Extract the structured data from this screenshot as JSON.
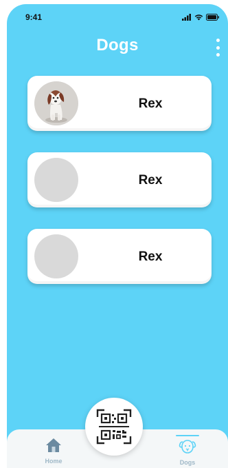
{
  "status_bar": {
    "time": "9:41"
  },
  "header": {
    "title": "Dogs"
  },
  "dogs": [
    {
      "name": "Rex",
      "has_photo": true
    },
    {
      "name": "Rex",
      "has_photo": false
    },
    {
      "name": "Rex",
      "has_photo": false
    }
  ],
  "tabs": [
    {
      "label": "Home",
      "icon": "home-icon",
      "active": false
    },
    {
      "label": "Dogs",
      "icon": "dog-icon",
      "active": true
    }
  ],
  "scan_button": {
    "icon": "qr-code-icon"
  },
  "colors": {
    "background": "#5dd3f7",
    "tab_inactive": "#9fb8c7",
    "card": "#ffffff"
  }
}
